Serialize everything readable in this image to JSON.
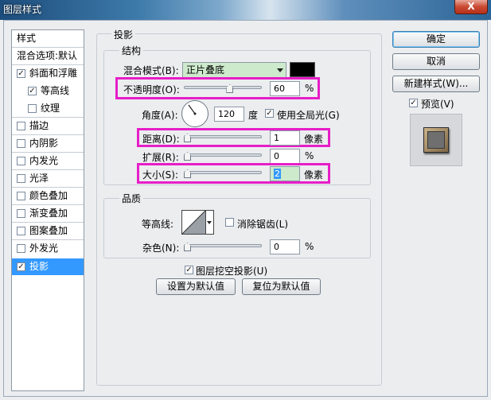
{
  "window": {
    "title": "图层样式",
    "close_label": "X"
  },
  "sidebar": {
    "header": "样式",
    "blend_default": "混合选项:默认",
    "items": [
      {
        "label": "斜面和浮雕",
        "checked": true
      },
      {
        "label": "等高线",
        "checked": true
      },
      {
        "label": "纹理",
        "checked": false
      },
      {
        "label": "描边",
        "checked": false
      },
      {
        "label": "内阴影",
        "checked": false
      },
      {
        "label": "内发光",
        "checked": false
      },
      {
        "label": "光泽",
        "checked": false
      },
      {
        "label": "颜色叠加",
        "checked": false
      },
      {
        "label": "渐变叠加",
        "checked": false
      },
      {
        "label": "图案叠加",
        "checked": false
      },
      {
        "label": "外发光",
        "checked": false
      },
      {
        "label": "投影",
        "checked": true,
        "selected": true
      }
    ]
  },
  "panel": {
    "title": "投影",
    "structure": {
      "title": "结构",
      "blend_mode_label": "混合模式(B):",
      "blend_mode_value": "正片叠底",
      "shadow_color": "#000000",
      "opacity_label": "不透明度(O):",
      "opacity_value": "60",
      "opacity_unit": "%",
      "opacity_fraction": 0.6,
      "angle_label": "角度(A):",
      "angle_value": "120",
      "angle_unit": "度",
      "global_light_label": "使用全局光(G)",
      "global_light_checked": true,
      "distance_label": "距离(D):",
      "distance_value": "1",
      "distance_unit": "像素",
      "distance_fraction": 0.0,
      "spread_label": "扩展(R):",
      "spread_value": "0",
      "spread_unit": "%",
      "spread_fraction": 0.0,
      "size_label": "大小(S):",
      "size_value": "2",
      "size_unit": "像素",
      "size_fraction": 0.0
    },
    "quality": {
      "title": "品质",
      "contour_label": "等高线:",
      "anti_alias_label": "消除锯齿(L)",
      "anti_alias_checked": false,
      "noise_label": "杂色(N):",
      "noise_value": "0",
      "noise_unit": "%",
      "noise_fraction": 0.0
    },
    "knockout_label": "图层挖空投影(U)",
    "knockout_checked": true,
    "make_default_label": "设置为默认值",
    "reset_default_label": "复位为默认值"
  },
  "buttons": {
    "ok": "确定",
    "cancel": "取消",
    "new_style": "新建样式(W)...",
    "preview_label": "预览(V)",
    "preview_checked": true
  },
  "colors": {
    "highlight": "#e61ec8",
    "selected_bg": "#3399ff",
    "combo_bg": "#cdeacc"
  }
}
